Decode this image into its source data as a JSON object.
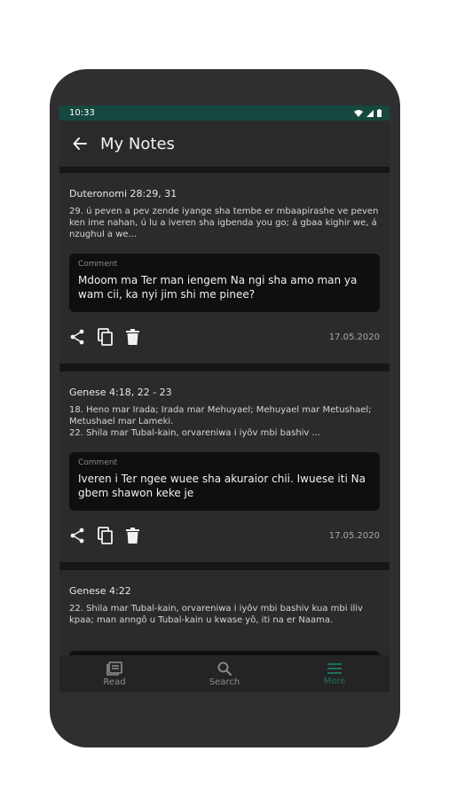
{
  "status_bar": {
    "time": "10:33"
  },
  "app_bar": {
    "title": "My Notes"
  },
  "notes": [
    {
      "reference": "Duteronomi 28:29, 31",
      "text": "29. ú peven a pev zende iyange sha tembe er mbaapirashe ve peven ken ime nahan, ú lu a iveren sha igbenda you go; á gbaa kighir we, á nzughul a we...",
      "comment_label": "Comment",
      "comment": "Mdoom ma Ter man iengem Na ngi sha amo man ya wam cii, ka nyi jim shi me pinee?",
      "date": "17.05.2020"
    },
    {
      "reference": "Genese 4:18, 22 - 23",
      "text": "18.  Heno mar Irada; Irada mar Mehuyael; Mehuyael mar Metushael; Metushael mar Lameki.\n22. Shila mar Tubal-kain, orvareniwa i iyôv mbi bashiv ...",
      "comment_label": "Comment",
      "comment": "Iveren i Ter ngee wuee sha akuraior chii. Iwuese iti Na gbem shawon keke je",
      "date": "17.05.2020"
    },
    {
      "reference": "Genese 4:22",
      "text": "22. Shila mar Tubal-kain, orvareniwa i iyôv mbi bashiv kua mbi iliv kpaa; man anngô u Tubal-kain u kwase yô, iti na er Naama.",
      "comment_label": "",
      "comment": "",
      "date": ""
    }
  ],
  "bottom_nav": {
    "items": [
      {
        "label": "Read",
        "icon": "book-icon"
      },
      {
        "label": "Search",
        "icon": "search-icon"
      },
      {
        "label": "More",
        "icon": "menu-icon"
      }
    ],
    "active": "More"
  },
  "colors": {
    "accent": "#1f6e5f",
    "status_bar": "#16483f",
    "card": "#2b2b2b",
    "comment_bg": "#0f0f0f"
  }
}
